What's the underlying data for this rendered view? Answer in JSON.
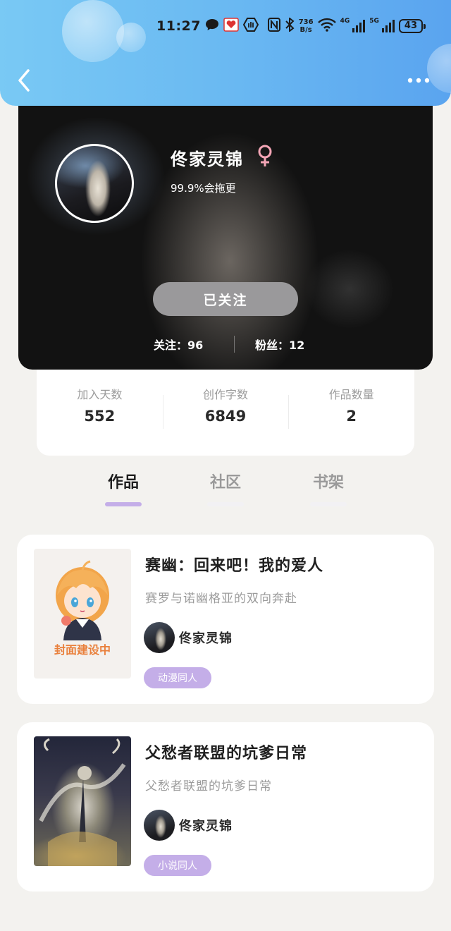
{
  "status_bar": {
    "time": "11:27",
    "speed_value": "736",
    "speed_unit": "B/s",
    "network_1": "4G",
    "network_2": "5G",
    "battery": "43"
  },
  "nav": {
    "back_icon": "chevron-left-icon",
    "more_icon": "more-dots-icon"
  },
  "profile": {
    "username": "佟家灵锦",
    "gender_icon": "female-icon",
    "gender_color": "#f3a5b5",
    "bio": "99.9%会拖更",
    "follow_button": "已关注",
    "following": "关注：96",
    "fans": "粉丝：12"
  },
  "stats": [
    {
      "label": "加入天数",
      "value": "552"
    },
    {
      "label": "创作字数",
      "value": "6849"
    },
    {
      "label": "作品数量",
      "value": "2"
    }
  ],
  "tabs": [
    {
      "label": "作品",
      "active": true
    },
    {
      "label": "社区",
      "active": false
    },
    {
      "label": "书架",
      "active": false
    }
  ],
  "accent_color": "#c4aee8",
  "works": [
    {
      "cover_text": "封面建设中",
      "title": "赛幽：回来吧！我的爱人",
      "description": "赛罗与诺幽格亚的双向奔赴",
      "author": "佟家灵锦",
      "tag": "动漫同人"
    },
    {
      "cover_text": "",
      "title": "父愁者联盟的坑爹日常",
      "description": "父愁者联盟的坑爹日常",
      "author": "佟家灵锦",
      "tag": "小说同人"
    }
  ]
}
